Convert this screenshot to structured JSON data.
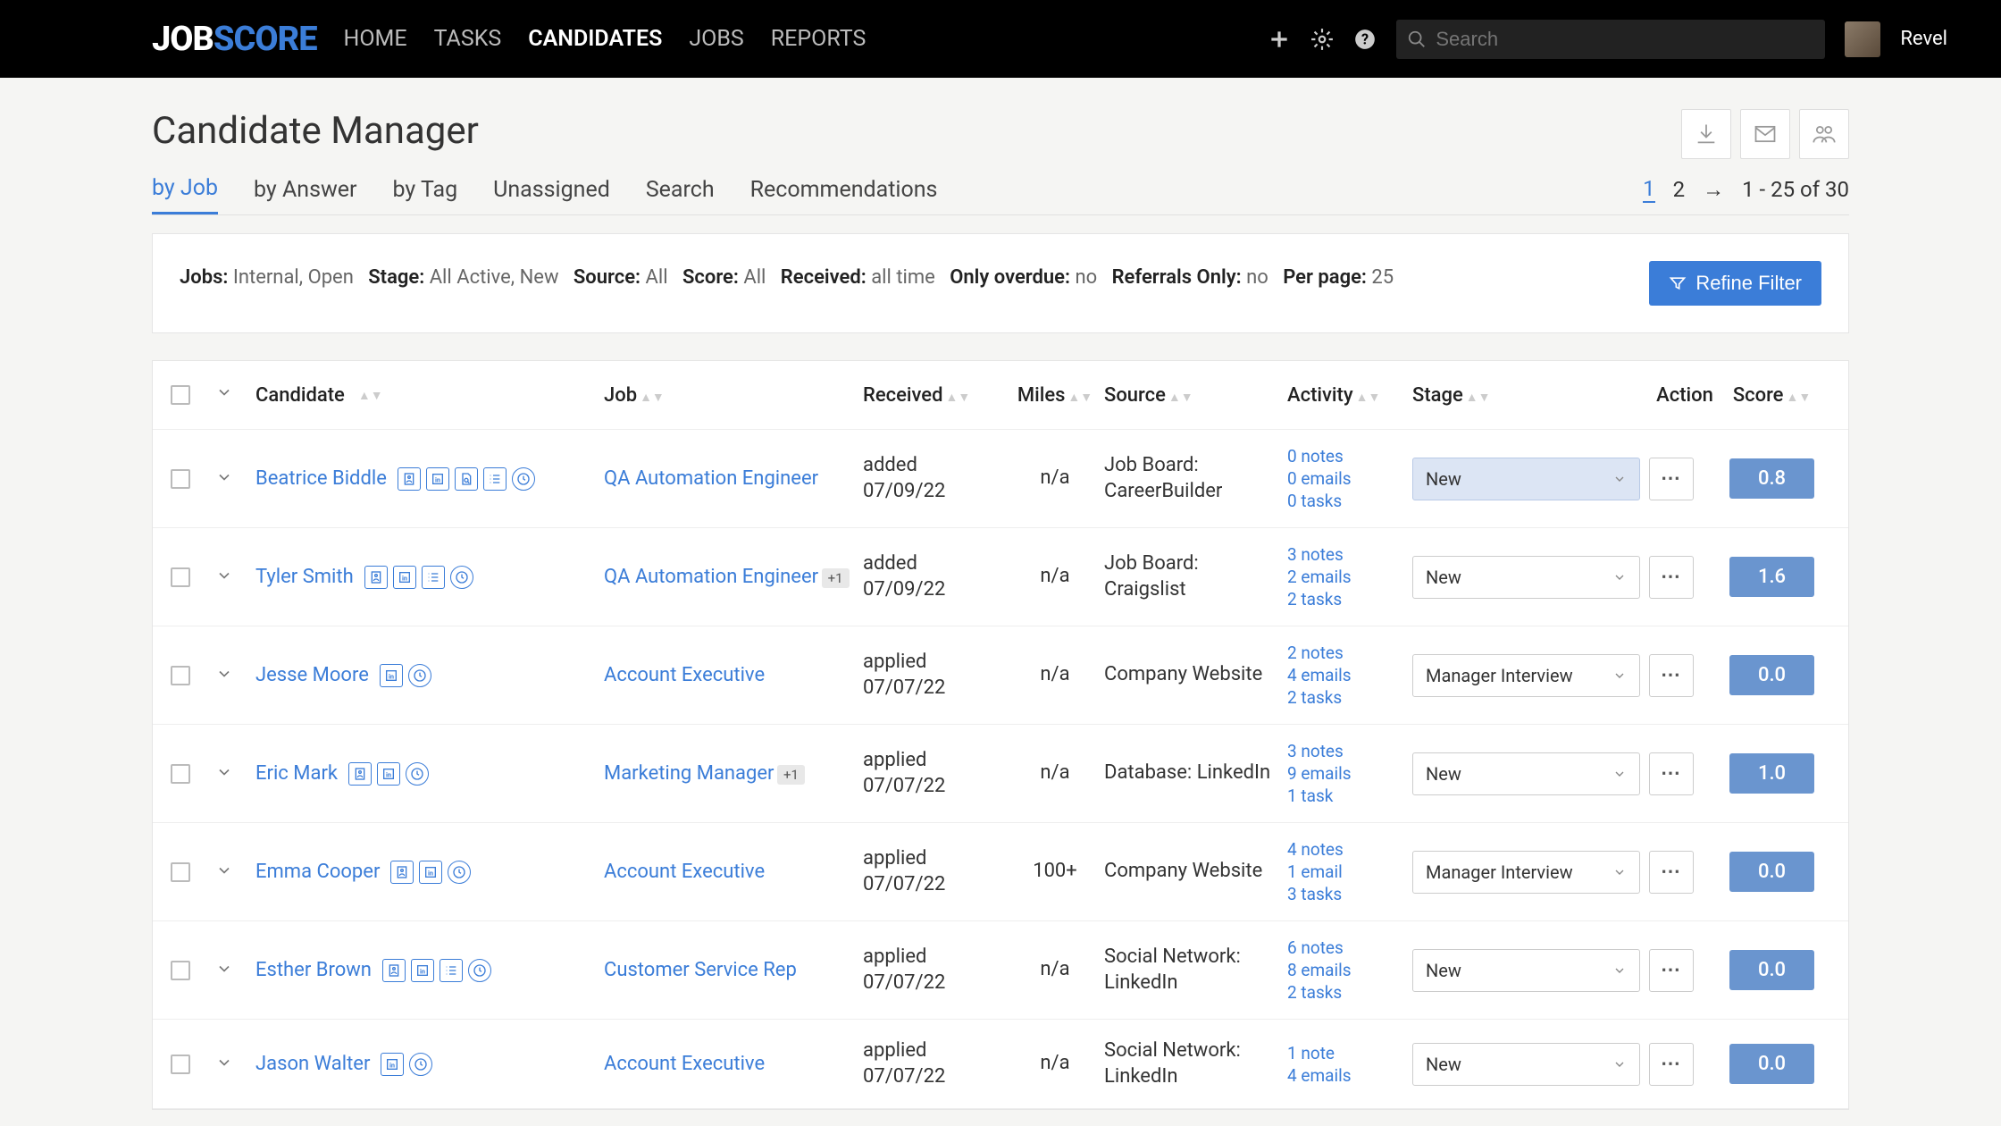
{
  "brand": {
    "part1": "JOB",
    "part2": "SCORE"
  },
  "nav": {
    "home": "HOME",
    "tasks": "TASKS",
    "candidates": "CANDIDATES",
    "jobs": "JOBS",
    "reports": "REPORTS"
  },
  "search": {
    "placeholder": "Search"
  },
  "user": {
    "name": "Revel"
  },
  "page_title": "Candidate Manager",
  "tabs": {
    "by_job": "by Job",
    "by_answer": "by Answer",
    "by_tag": "by Tag",
    "unassigned": "Unassigned",
    "search": "Search",
    "recommendations": "Recommendations"
  },
  "pager": {
    "p1": "1",
    "p2": "2",
    "arrow": "→",
    "range": "1 - 25 of 30"
  },
  "filters": {
    "jobs_label": "Jobs:",
    "jobs_val": "Internal, Open",
    "stage_label": "Stage:",
    "stage_val": "All Active, New",
    "source_label": "Source:",
    "source_val": "All",
    "score_label": "Score:",
    "score_val": "All",
    "received_label": "Received:",
    "received_val": "all time",
    "overdue_label": "Only overdue:",
    "overdue_val": "no",
    "referrals_label": "Referrals Only:",
    "referrals_val": "no",
    "perpage_label": "Per page:",
    "perpage_val": "25",
    "refine": "Refine Filter"
  },
  "columns": {
    "candidate": "Candidate",
    "job": "Job",
    "received": "Received",
    "miles": "Miles",
    "source": "Source",
    "activity": "Activity",
    "stage": "Stage",
    "action": "Action",
    "score": "Score"
  },
  "rows": [
    {
      "name": "Beatrice Biddle",
      "icons": [
        "resume",
        "linkedin",
        "doc",
        "list",
        "clock"
      ],
      "job": "QA Automation Engineer",
      "job_badge": "",
      "received_line1": "added",
      "received_line2": "07/09/22",
      "miles": "n/a",
      "source": "Job Board: CareerBuilder",
      "notes": "0 notes",
      "emails": "0 emails",
      "tasks": "0 tasks",
      "stage": "New",
      "stage_highlight": true,
      "score": "0.8"
    },
    {
      "name": "Tyler Smith",
      "icons": [
        "resume",
        "linkedin",
        "list",
        "clock"
      ],
      "job": "QA Automation Engineer",
      "job_badge": "+1",
      "received_line1": "added",
      "received_line2": "07/09/22",
      "miles": "n/a",
      "source": "Job Board: Craigslist",
      "notes": "3 notes",
      "emails": "2 emails",
      "tasks": "2 tasks",
      "stage": "New",
      "stage_highlight": false,
      "score": "1.6"
    },
    {
      "name": "Jesse Moore",
      "icons": [
        "linkedin",
        "clock"
      ],
      "job": "Account Executive",
      "job_badge": "",
      "received_line1": "applied",
      "received_line2": "07/07/22",
      "miles": "n/a",
      "source": "Company Website",
      "notes": "2 notes",
      "emails": "4 emails",
      "tasks": "2 tasks",
      "stage": "Manager Interview",
      "stage_highlight": false,
      "score": "0.0"
    },
    {
      "name": "Eric Mark",
      "icons": [
        "resume",
        "linkedin",
        "clock"
      ],
      "job": "Marketing Manager",
      "job_badge": "+1",
      "received_line1": "applied",
      "received_line2": "07/07/22",
      "miles": "n/a",
      "source": "Database: LinkedIn",
      "notes": "3 notes",
      "emails": "9 emails",
      "tasks": "1 task",
      "stage": "New",
      "stage_highlight": false,
      "score": "1.0"
    },
    {
      "name": "Emma Cooper",
      "icons": [
        "resume",
        "linkedin",
        "clock"
      ],
      "job": "Account Executive",
      "job_badge": "",
      "received_line1": "applied",
      "received_line2": "07/07/22",
      "miles": "100+",
      "source": "Company Website",
      "notes": "4 notes",
      "emails": "1 email",
      "tasks": "3 tasks",
      "stage": "Manager Interview",
      "stage_highlight": false,
      "score": "0.0"
    },
    {
      "name": "Esther Brown",
      "icons": [
        "resume",
        "linkedin",
        "list",
        "clock"
      ],
      "job": "Customer Service Rep",
      "job_badge": "",
      "received_line1": "applied",
      "received_line2": "07/07/22",
      "miles": "n/a",
      "source": "Social Network: LinkedIn",
      "notes": "6 notes",
      "emails": "8 emails",
      "tasks": "2 tasks",
      "stage": "New",
      "stage_highlight": false,
      "score": "0.0"
    },
    {
      "name": "Jason Walter",
      "icons": [
        "linkedin",
        "clock"
      ],
      "job": "Account Executive",
      "job_badge": "",
      "received_line1": "applied",
      "received_line2": "07/07/22",
      "miles": "n/a",
      "source": "Social Network: LinkedIn",
      "notes": "1 note",
      "emails": "4 emails",
      "tasks": "",
      "stage": "New",
      "stage_highlight": false,
      "score": "0.0"
    }
  ]
}
